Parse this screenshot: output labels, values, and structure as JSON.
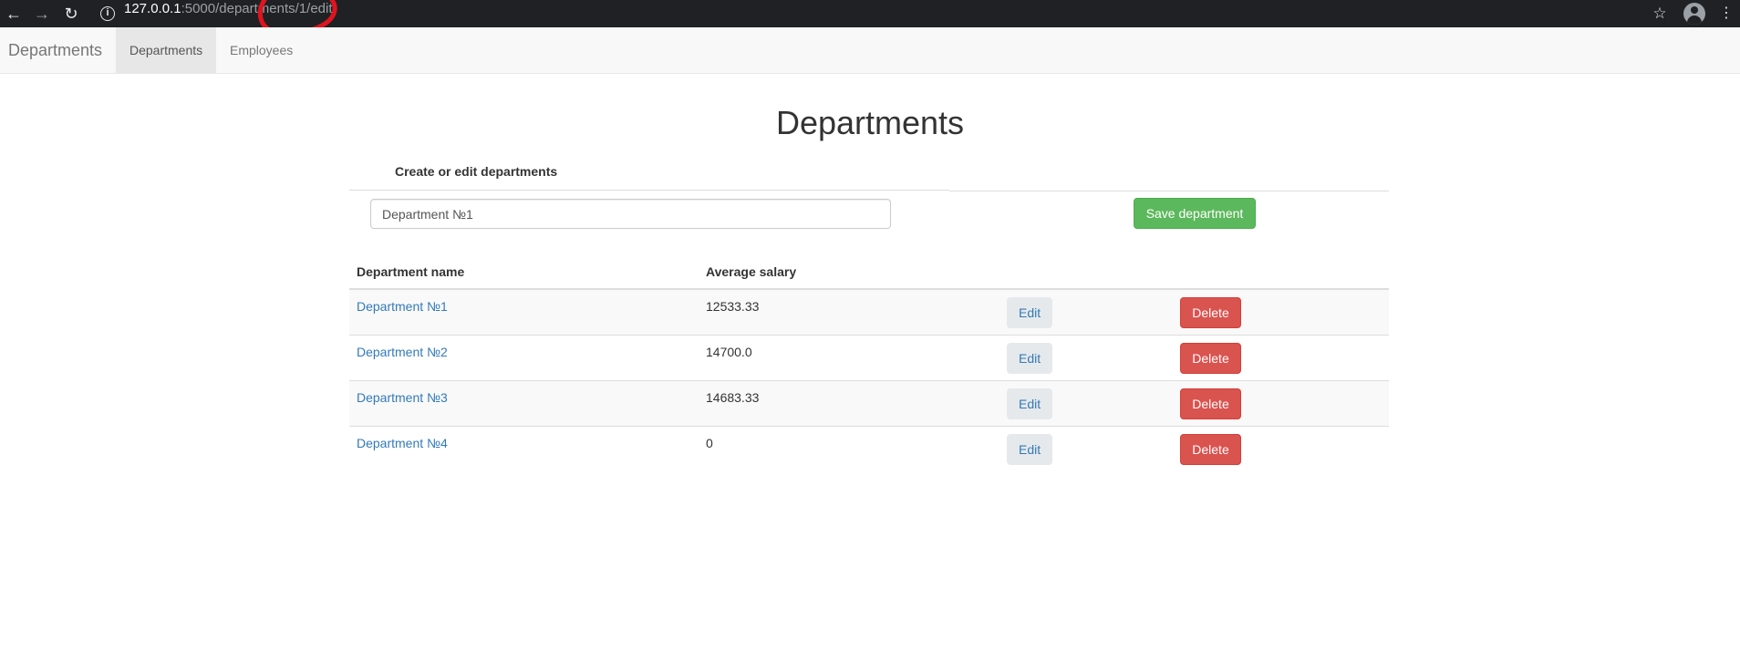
{
  "browser": {
    "url_host": "127.0.0.1",
    "url_path": ":5000/departments/1/edit"
  },
  "navbar": {
    "brand": "Departments",
    "items": [
      {
        "label": "Departments",
        "active": true
      },
      {
        "label": "Employees",
        "active": false
      }
    ]
  },
  "page": {
    "title": "Departments",
    "form_label": "Create or edit departments",
    "name_value": "Department №1",
    "save_label": "Save department"
  },
  "table": {
    "headers": [
      "Department name",
      "Average salary"
    ],
    "rows": [
      {
        "name": "Department №1",
        "salary": "12533.33"
      },
      {
        "name": "Department №2",
        "salary": "14700.0"
      },
      {
        "name": "Department №3",
        "salary": "14683.33"
      },
      {
        "name": "Department №4",
        "salary": "0"
      }
    ],
    "edit_label": "Edit",
    "delete_label": "Delete"
  },
  "colors": {
    "success": "#5cb85c",
    "danger": "#d9534f",
    "link": "#337ab7",
    "annotation": "#e0141e"
  },
  "icons": [
    "back-arrow-icon",
    "forward-arrow-icon",
    "reload-icon",
    "info-icon",
    "star-icon",
    "account-icon",
    "more-vert-icon"
  ]
}
